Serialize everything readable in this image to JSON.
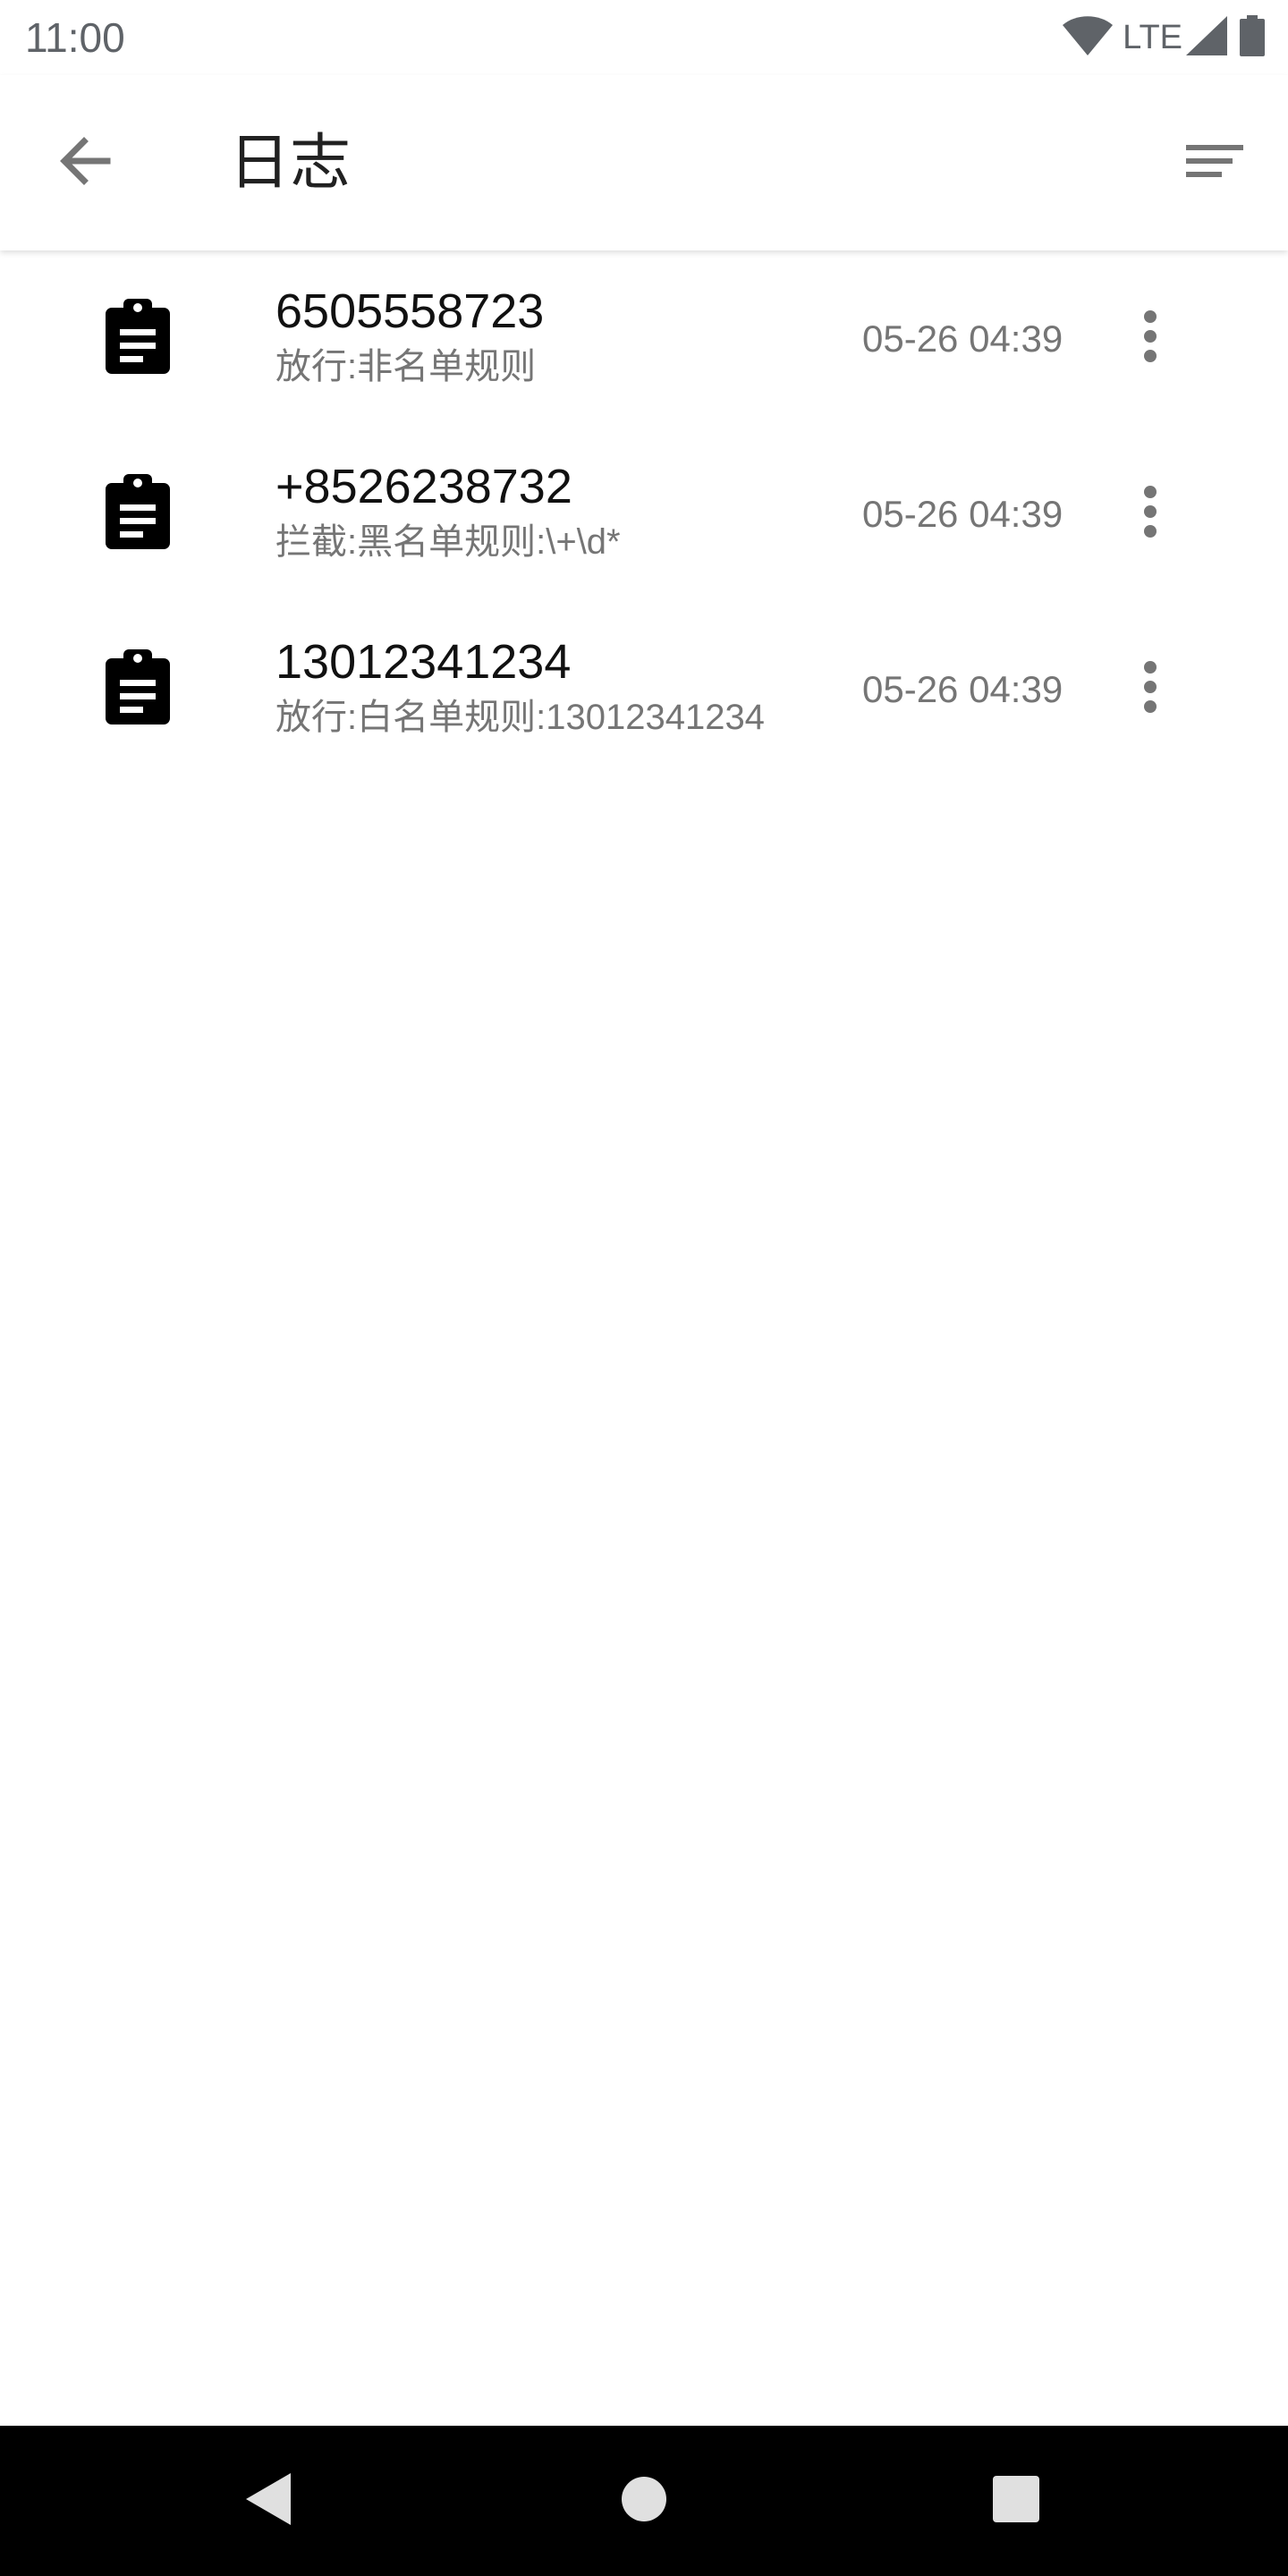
{
  "status_bar": {
    "time": "11:00",
    "network": "LTE",
    "icons": [
      "wifi-icon",
      "signal-icon",
      "battery-icon"
    ]
  },
  "app_bar": {
    "title": "日志",
    "back_icon": "arrow-back-icon",
    "sort_icon": "sort-icon"
  },
  "logs": [
    {
      "number": "6505558723",
      "rule": "放行:非名单规则",
      "time": "05-26 04:39",
      "icon": "clipboard-icon"
    },
    {
      "number": "+8526238732",
      "rule": "拦截:黑名单规则:\\+\\d*",
      "time": "05-26 04:39",
      "icon": "clipboard-icon"
    },
    {
      "number": "13012341234",
      "rule": "放行:白名单规则:13012341234",
      "time": "05-26 04:39",
      "icon": "clipboard-icon"
    }
  ],
  "nav_bar": {
    "icons": [
      "nav-back-icon",
      "nav-home-icon",
      "nav-recents-icon"
    ]
  },
  "colors": {
    "icon_gray": "#757575",
    "text_primary": "#111111",
    "text_secondary": "#757575",
    "nav_background": "#000000"
  }
}
